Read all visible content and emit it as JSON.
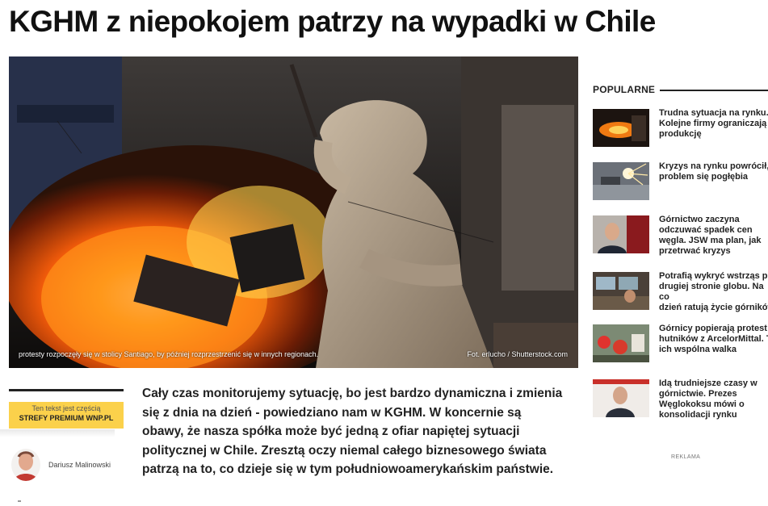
{
  "article": {
    "headline": "KGHM z niepokojem patrzy na wypadki w Chile",
    "image_caption": "protesty rozpoczęły się w stolicy Santiago, by później rozprzestrzenić się w innych regionach.",
    "image_credit": "Fot. erlucho / Shutterstock.com",
    "lead": "Cały czas monitorujemy sytuację, bo jest bardzo dynamiczna i zmienia się z dnia na dzień - powiedziano nam w KGHM. W koncernie są obawy, że nasza spółka może być jedną z ofiar napiętej sytuacji politycznej w Chile. Zresztą oczy niemal całego biznesowego świata patrzą na to, co dzieje się w tym południowoamerykańskim państwie."
  },
  "premium": {
    "line1": "Ten tekst jest częścią",
    "line2": "STREFY PREMIUM WNP.PL"
  },
  "author": {
    "name": "Dariusz Malinowski"
  },
  "sidebar": {
    "title": "POPULARNE",
    "items": [
      {
        "title": "Trudna sytuacja na rynku.\nKolejne firmy ograniczają\nprodukcję",
        "icon": "furnace-photo"
      },
      {
        "title": "Kryzys na rynku powrócił,\nproblem się pogłębia",
        "icon": "sparks-photo"
      },
      {
        "title": "Górnictwo zaczyna\nodczuwać spadek cen\nwęgla. JSW ma plan, jak\nprzetrwać kryzys",
        "icon": "portrait-photo"
      },
      {
        "title": "Potrafią wykryć wstrząs po\ndrugiej stronie globu. Na co\ndzień ratują życie górników",
        "icon": "control-room-photo"
      },
      {
        "title": "Górnicy popierają protest\nhutników z ArcelorMittal. T\nich wspólna walka",
        "icon": "protest-photo"
      },
      {
        "title": "Idą trudniejsze czasy w\ngórnictwie. Prezes\nWęglokoksu mówi o\nkonsolidacji rynku",
        "icon": "speaker-photo"
      }
    ]
  },
  "ad": {
    "label": "REKLAMA"
  },
  "colors": {
    "premium_yellow": "#fbd14b",
    "text_dark": "#222222"
  }
}
